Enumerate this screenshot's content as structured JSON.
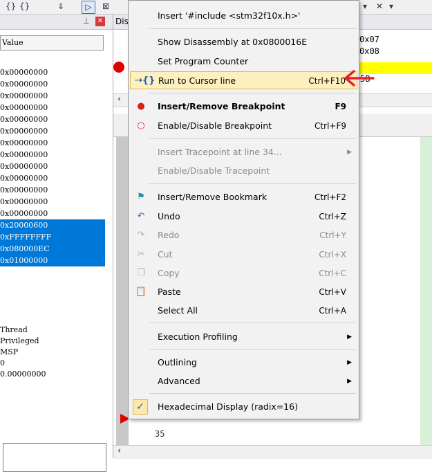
{
  "toolbar": {
    "items": [
      "{}",
      "{}",
      "⇓",
      "▷",
      "⊠",
      "▾",
      "✕",
      "▾"
    ]
  },
  "left_panel": {
    "column_header": "Value",
    "registers": [
      "0x00000000",
      "0x00000000",
      "0x00000000",
      "0x00000000",
      "0x00000000",
      "0x00000000",
      "0x00000000",
      "0x00000000",
      "0x00000000",
      "0x00000000",
      "0x00000000",
      "0x00000000",
      "0x00000000"
    ],
    "selected_registers": [
      "0x20000600",
      "0xFFFFFFFF",
      "0x080000EC",
      "0x01000000"
    ],
    "mode_values": [
      "Thread",
      "Privileged",
      "MSP",
      "0",
      "0.00000000"
    ]
  },
  "disassembly": {
    "title": "Dis",
    "lines": [
      "0x07",
      "0x08"
    ],
    "highlight_text": "5B"
  },
  "editor": {
    "line_number": "35"
  },
  "context_menu": {
    "items": [
      {
        "label": "Insert '#include <stm32f10x.h>'",
        "shortcut": "",
        "disabled": false
      },
      {
        "label": "Show Disassembly at 0x0800016E",
        "shortcut": "",
        "disabled": false
      },
      {
        "label": "Set Program Counter",
        "shortcut": "",
        "disabled": false
      },
      {
        "label": "Run to Cursor line",
        "shortcut": "Ctrl+F10",
        "disabled": false
      },
      {
        "label": "Insert/Remove Breakpoint",
        "shortcut": "F9",
        "disabled": false
      },
      {
        "label": "Enable/Disable Breakpoint",
        "shortcut": "Ctrl+F9",
        "disabled": false
      },
      {
        "label": "Insert Tracepoint at line 34...",
        "shortcut": "",
        "disabled": true
      },
      {
        "label": "Enable/Disable Tracepoint",
        "shortcut": "",
        "disabled": true
      },
      {
        "label": "Insert/Remove Bookmark",
        "shortcut": "Ctrl+F2",
        "disabled": false
      },
      {
        "label": "Undo",
        "shortcut": "Ctrl+Z",
        "disabled": false
      },
      {
        "label": "Redo",
        "shortcut": "Ctrl+Y",
        "disabled": true
      },
      {
        "label": "Cut",
        "shortcut": "Ctrl+X",
        "disabled": true
      },
      {
        "label": "Copy",
        "shortcut": "Ctrl+C",
        "disabled": true
      },
      {
        "label": "Paste",
        "shortcut": "Ctrl+V",
        "disabled": false
      },
      {
        "label": "Select All",
        "shortcut": "Ctrl+A",
        "disabled": false
      },
      {
        "label": "Execution Profiling",
        "shortcut": "",
        "disabled": false
      },
      {
        "label": "Outlining",
        "shortcut": "",
        "disabled": false
      },
      {
        "label": "Advanced",
        "shortcut": "",
        "disabled": false
      },
      {
        "label": "Hexadecimal Display (radix=16)",
        "shortcut": "",
        "disabled": false
      }
    ]
  },
  "colors": {
    "selection": "#0078d7",
    "menu_highlight": "#fdf0c0",
    "breakpoint": "#e00000",
    "annotation_arrow": "#e8202a"
  }
}
